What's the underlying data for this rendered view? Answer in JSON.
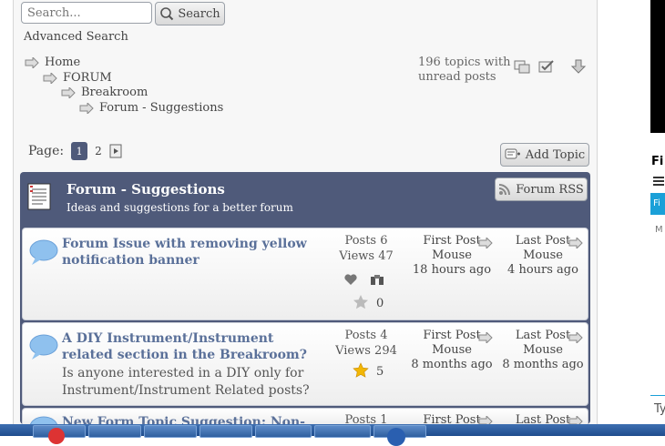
{
  "search": {
    "placeholder": "Search...",
    "button_label": "Search"
  },
  "advanced_search_label": "Advanced Search",
  "breadcrumb": [
    "Home",
    "FORUM",
    "Breakroom",
    "Forum - Suggestions"
  ],
  "unread_text": [
    "196 topics with",
    "unread posts"
  ],
  "pagination": {
    "label": "Page:",
    "current": "1",
    "next": "2"
  },
  "add_topic_label": "Add Topic",
  "forum": {
    "title": "Forum - Suggestions",
    "description": "Ideas and suggestions for a better forum",
    "rss_label": "Forum RSS"
  },
  "topics": [
    {
      "title": "Forum Issue with removing yellow notification banner",
      "excerpt": "",
      "posts": "Posts 6",
      "views": "Views 47",
      "rating": "0",
      "first_post_label": "First Post",
      "first_author": "Mouse",
      "first_time": "18 hours ago",
      "last_post_label": "Last Post",
      "last_author": "Mouse",
      "last_time": "4 hours ago"
    },
    {
      "title": "A DIY Instrument/Instrument related section in the Breakroom?",
      "excerpt": "Is anyone interested in a DIY only for Instrument/Instrument Related posts?",
      "posts": "Posts 4",
      "views": "Views 294",
      "rating": "5",
      "first_post_label": "First Post",
      "first_author": "Mouse",
      "first_time": "8 months ago",
      "last_post_label": "Last Post",
      "last_author": "Mouse",
      "last_time": "8 months ago"
    },
    {
      "title": "New Form Topic Suggestion: Non-",
      "posts": "Posts 1",
      "first_post_label": "First Post",
      "last_post_label": "Last Post"
    }
  ],
  "sidebar": {
    "heading_fragment": "Fi",
    "tab_fragment": "Fi",
    "letter_fragment": "M",
    "type_fragment": "Ty"
  },
  "colors": {
    "header": "#4f5a7a",
    "topic_title": "#5a7099",
    "accent": "#1aa0d8",
    "star": "#f2b705"
  }
}
